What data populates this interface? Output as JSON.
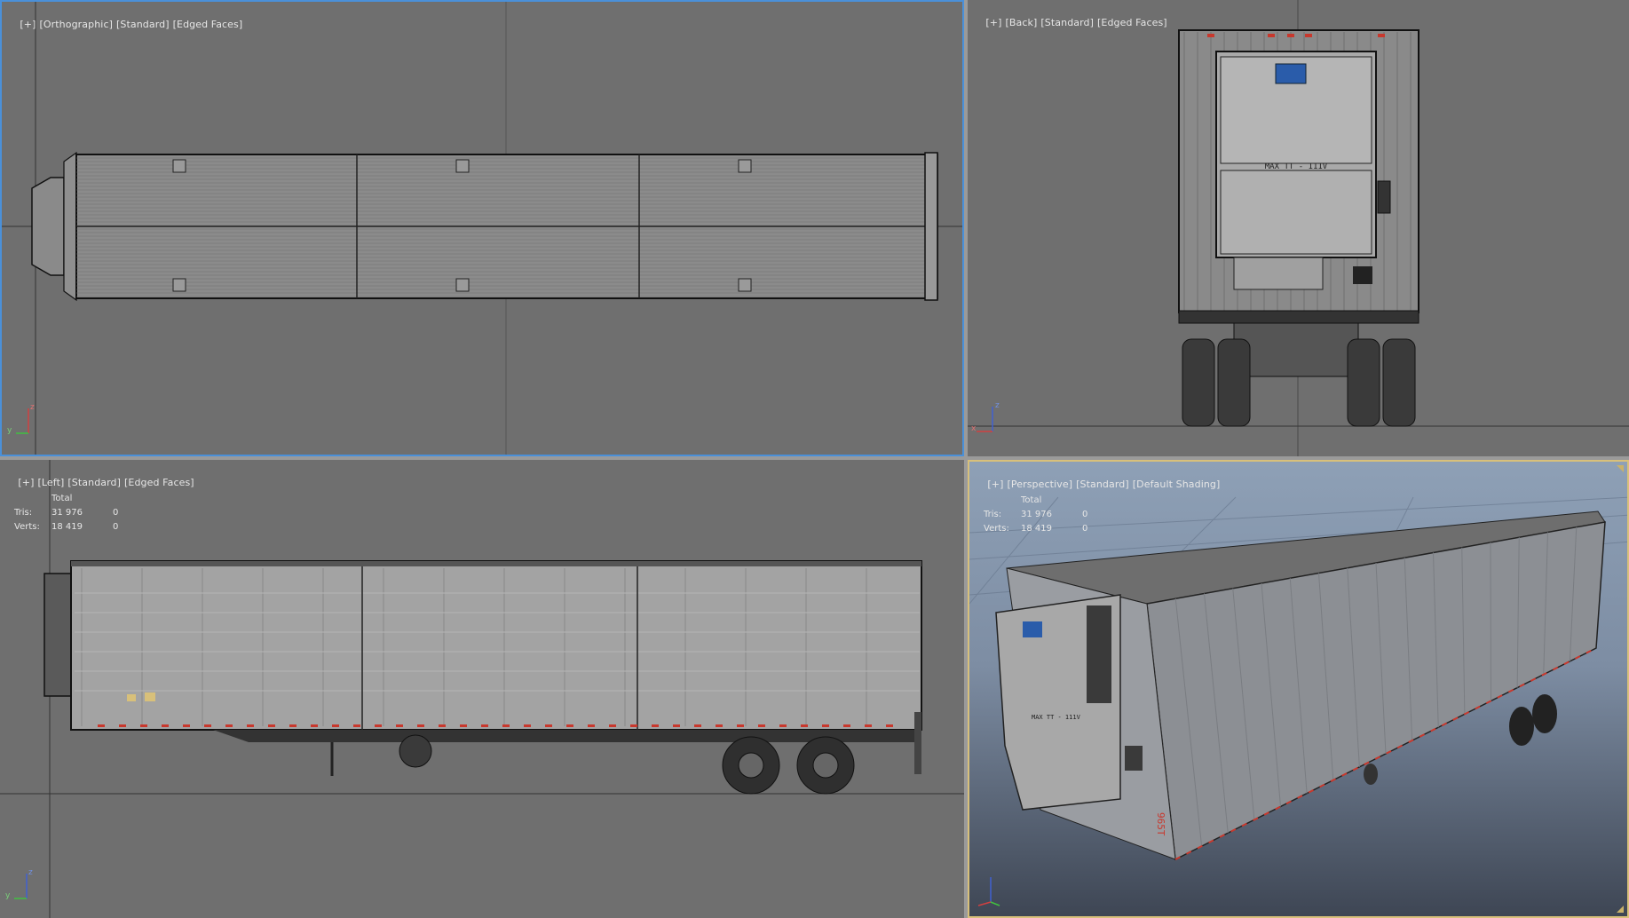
{
  "viewports": {
    "top": {
      "label": [
        "[+]",
        "[Orthographic]",
        "[Standard]",
        "[Edged Faces]"
      ],
      "gizmo": {
        "x": "y",
        "y": "z"
      }
    },
    "back": {
      "label": [
        "[+]",
        "[Back]",
        "[Standard]",
        "[Edged Faces]"
      ],
      "gizmo": {
        "x": "x",
        "y": "z"
      }
    },
    "left": {
      "label": [
        "[+]",
        "[Left]",
        "[Standard]",
        "[Edged Faces]"
      ],
      "gizmo": {
        "x": "y",
        "y": "z"
      },
      "stats": {
        "header": "Total",
        "rows": [
          {
            "name": "Tris:",
            "total": "31 976",
            "sel": "0"
          },
          {
            "name": "Verts:",
            "total": "18 419",
            "sel": "0"
          }
        ]
      }
    },
    "persp": {
      "label": [
        "[+]",
        "[Perspective]",
        "[Standard]",
        "[Default Shading]"
      ],
      "stats": {
        "header": "Total",
        "rows": [
          {
            "name": "Tris:",
            "total": "31 976",
            "sel": "0"
          },
          {
            "name": "Verts:",
            "total": "18 419",
            "sel": "0"
          }
        ]
      }
    }
  },
  "trailer_text": {
    "unit_text": "MAX TT - 111V",
    "rear_plate": "965T"
  },
  "colors": {
    "viewport_bg": "#6f6f6f",
    "active_border": "#4a90d9",
    "marker_lights": "#c8382d"
  }
}
